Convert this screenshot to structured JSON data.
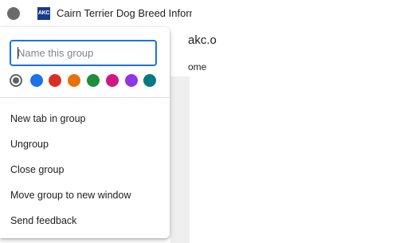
{
  "tab": {
    "favicon_text": "AKC",
    "title": "Cairn Terrier Dog Breed Information"
  },
  "omnibox": {
    "visible_text": "akc.o"
  },
  "bookmarks": {
    "visible_text": "ome"
  },
  "popup": {
    "name_input": {
      "value": "",
      "placeholder": "Name this group"
    },
    "colors": [
      {
        "name": "grey",
        "hex": "#5f6368",
        "selected": true
      },
      {
        "name": "blue",
        "hex": "#1a73e8"
      },
      {
        "name": "red",
        "hex": "#d93025"
      },
      {
        "name": "yellow",
        "hex": "#e8710a"
      },
      {
        "name": "green",
        "hex": "#1e8e3e"
      },
      {
        "name": "pink",
        "hex": "#d01884"
      },
      {
        "name": "purple",
        "hex": "#9334e6"
      },
      {
        "name": "cyan",
        "hex": "#007b83"
      }
    ],
    "menu": [
      {
        "label": "New tab in group"
      },
      {
        "label": "Ungroup"
      },
      {
        "label": "Close group"
      },
      {
        "label": "Move group to new window"
      },
      {
        "label": "Send feedback"
      }
    ]
  }
}
